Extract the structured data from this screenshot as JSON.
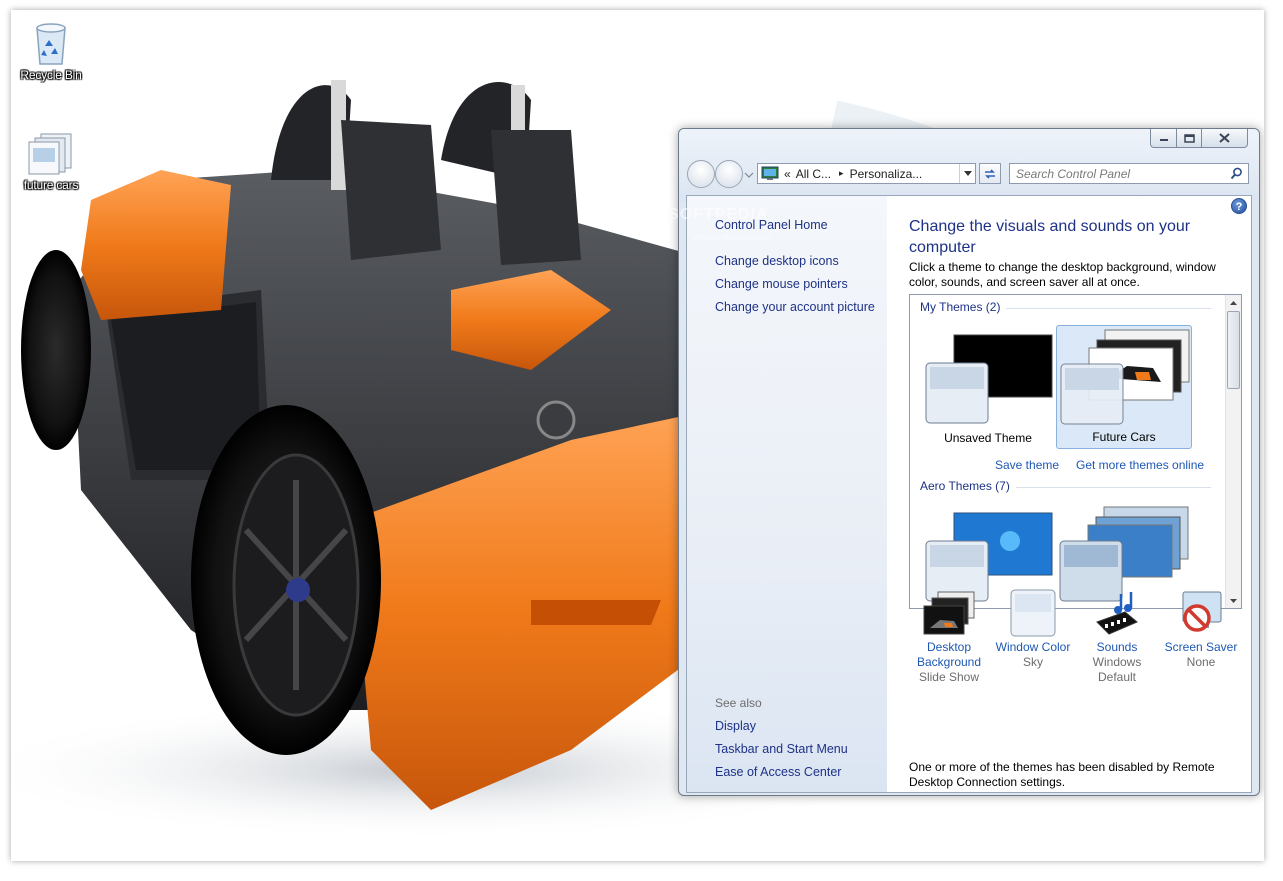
{
  "desktop": {
    "icons": [
      {
        "label": "Recycle Bin",
        "icon": "recycle-bin-icon"
      },
      {
        "label": "future cars",
        "icon": "theme-pack-icon"
      }
    ],
    "watermark": "SOFTPEDIA",
    "watermark_url": "www.softpedia.com"
  },
  "window": {
    "nav": {
      "address_chevron": "«",
      "address_crumb_1": "All C...",
      "address_separator": "▸",
      "address_crumb_2": "Personaliza...",
      "search_placeholder": "Search Control Panel"
    },
    "left_pane": {
      "home_link": "Control Panel Home",
      "tasks": [
        "Change desktop icons",
        "Change mouse pointers",
        "Change your account picture"
      ],
      "see_also_heading": "See also",
      "see_also": [
        "Display",
        "Taskbar and Start Menu",
        "Ease of Access Center"
      ]
    },
    "content": {
      "title": "Change the visuals and sounds on your computer",
      "description": "Click a theme to change the desktop background, window color, sounds, and screen saver all at once.",
      "help": "?",
      "groups": {
        "my_themes": "My Themes (2)",
        "aero_themes": "Aero Themes (7)"
      },
      "themes": [
        {
          "name": "Unsaved Theme",
          "selected": false
        },
        {
          "name": "Future Cars",
          "selected": true
        }
      ],
      "save_theme_link": "Save theme",
      "get_more_link": "Get more themes online",
      "bottom": [
        {
          "label": "Desktop Background",
          "sub": "Slide Show",
          "icon": "desktop-background-icon"
        },
        {
          "label": "Window Color",
          "sub": "Sky",
          "icon": "window-color-icon"
        },
        {
          "label": "Sounds",
          "sub": "Windows Default",
          "icon": "sounds-icon"
        },
        {
          "label": "Screen Saver",
          "sub": "None",
          "icon": "screen-saver-icon"
        }
      ],
      "note": "One or more of the themes has been disabled by Remote Desktop Connection settings."
    }
  },
  "colors": {
    "link": "#1e3287",
    "link_secondary": "#1e58b3",
    "car_orange": "#f07a1a",
    "selection": "#dbe8f7"
  }
}
